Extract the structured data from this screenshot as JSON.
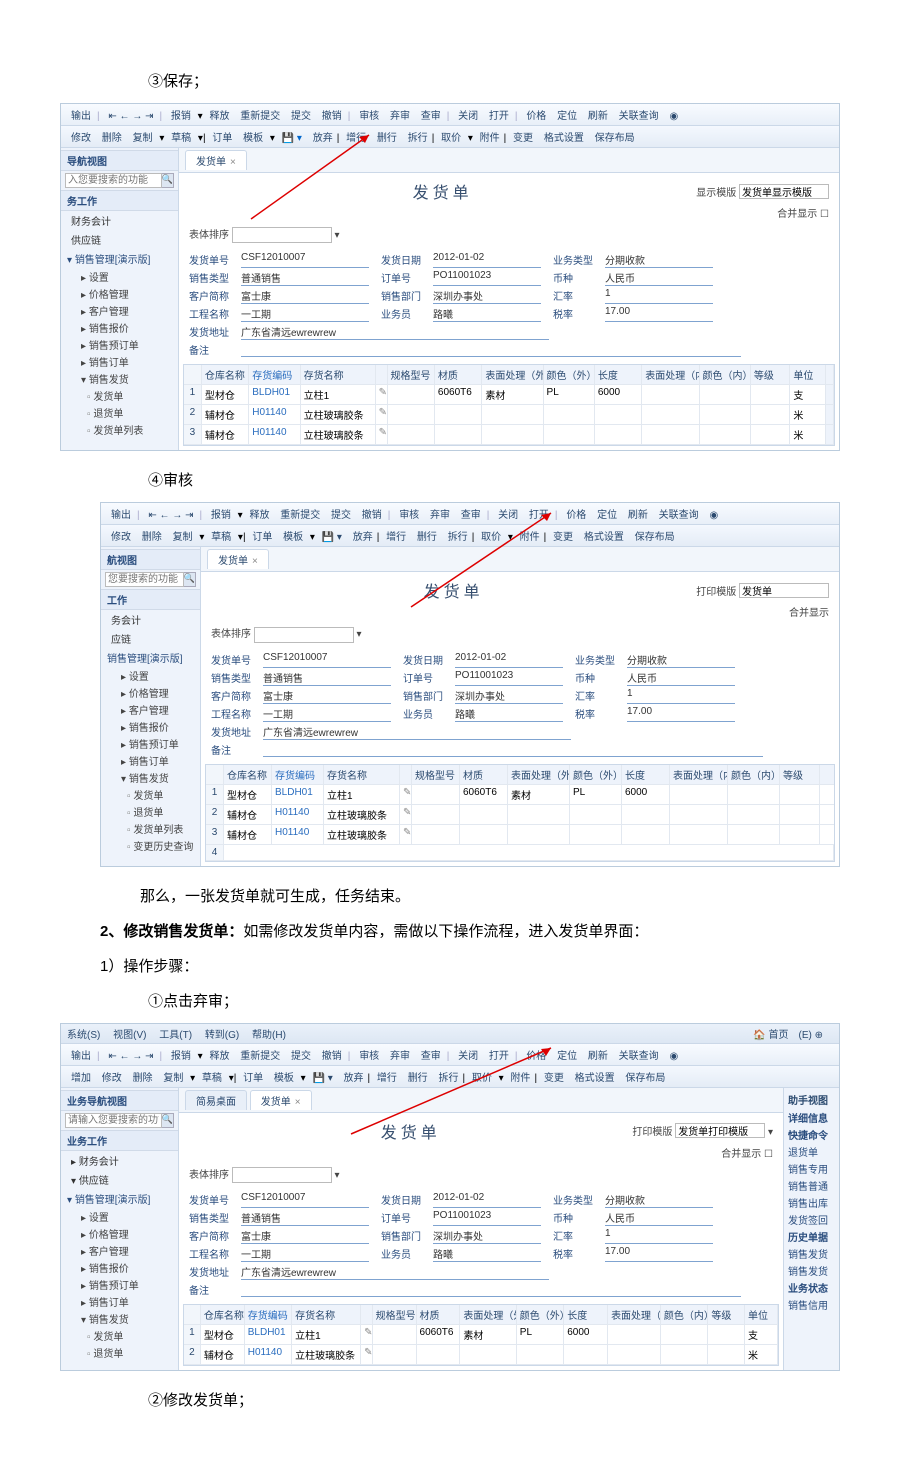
{
  "doc": {
    "step3": "③保存；",
    "step4": "④审核",
    "mid_sentence": "那么，一张发货单就可生成，任务结束。",
    "sec2_title": "2、修改销售发货单：",
    "sec2_body": "如需修改发货单内容，需做以下操作流程，进入发货单界面：",
    "sec2_steps_label": "1）操作步骤：",
    "step2_1": "①点击弃审；",
    "step2_2": "②修改发货单；"
  },
  "tb": {
    "output": "输出",
    "baogao": "报销",
    "shifang": "释放",
    "resubmit": "重新提交",
    "submit": "提交",
    "revoke": "撤销",
    "shenhe": "审核",
    "qishen": "弃审",
    "chashen": "查审",
    "close": "关闭",
    "open": "打开",
    "price": "价格",
    "locate": "定位",
    "refresh": "刷新",
    "relquery": "关联查询",
    "add": "增加",
    "modify": "修改",
    "delete": "删除",
    "copy": "复制",
    "draft": "草稿",
    "order": "订单",
    "template": "模板",
    "abandon": "放弃",
    "zengxing": "增行",
    "shanhang": "删行",
    "zhihang": "拆行",
    "quxia": "取价",
    "attach": "附件",
    "change": "变更",
    "format": "格式设置",
    "savelayout": "保存布局"
  },
  "nav": {
    "header": "导航视图",
    "search_ph": "入您要搜索的功能",
    "search_ph2": "请输入您要搜索的功能",
    "biz": "业务工作",
    "fin": "财务会计",
    "supply": "供应链",
    "salesmgr": "销售管理[演示版]",
    "setting": "设置",
    "pricemgr": "价格管理",
    "custmgr": "客户管理",
    "quote": "销售报价",
    "preorder": "销售预订单",
    "order": "销售订单",
    "ship": "销售发货",
    "ship_doc": "发货单",
    "return_doc": "退货单",
    "ship_list": "发货单列表",
    "history": "变更历史查询",
    "biz2": "务工作",
    "fin2": "务会计",
    "supply2": "应链",
    "work": "工作",
    "nav_header2": "航视图",
    "search_ph3": "您要搜索的功能",
    "abbr_fin": "务会计",
    "simple_desktop": "简易桌面"
  },
  "form": {
    "tab_label": "发货单",
    "tab_close": "×",
    "title": "发货单",
    "tmpl_label": "显示模版",
    "tmpl_val": "发货单显示模版",
    "tmpl_label2": "打印模版",
    "tmpl_val2": "发货单",
    "tmpl_val3": "发货单打印模版",
    "merge": "合并显示",
    "sort_label": "表体排序",
    "f_doc_no": "发货单号",
    "v_doc_no": "CSF12010007",
    "f_date": "发货日期",
    "v_date": "2012-01-02",
    "f_biztype": "业务类型",
    "v_biztype": "分期收款",
    "f_saletype": "销售类型",
    "v_saletype": "普通销售",
    "f_orderno": "订单号",
    "v_orderno": "PO11001023",
    "f_currency": "币种",
    "v_currency": "人民币",
    "f_cust": "客户简称",
    "v_cust": "富士康",
    "f_dept": "销售部门",
    "v_dept": "深圳办事处",
    "f_rate": "汇率",
    "v_rate": "1",
    "f_proj": "工程名称",
    "v_proj": "一工期",
    "f_salesman": "业务员",
    "v_salesman": "路曦",
    "f_tax": "税率",
    "v_tax": "17.00",
    "f_addr": "发货地址",
    "v_addr": "广东省清远ewrewrew",
    "f_remark": "备注"
  },
  "grid": {
    "h_wh": "仓库名称",
    "h_code": "存货编码",
    "h_name": "存货名称",
    "h_spec": "规格型号",
    "h_mat": "材质",
    "h_surf": "表面处理（外）",
    "h_color": "颜色（外）",
    "h_len": "长度",
    "h_surf2": "表面处理（内）",
    "h_color2": "颜色（内）",
    "h_grade": "等级",
    "h_unit": "单位",
    "rows": [
      {
        "n": "1",
        "wh": "型材仓",
        "code": "BLDH01",
        "name": "立柱1",
        "pen": "✎",
        "spec": "",
        "mat": "6060T6",
        "surf": "素材",
        "color": "PL",
        "len": "6000",
        "unit": "支"
      },
      {
        "n": "2",
        "wh": "辅材仓",
        "code": "H01140",
        "name": "立柱玻璃胶条",
        "pen": "✎",
        "spec": "",
        "mat": "",
        "surf": "",
        "color": "",
        "len": "",
        "unit": "米"
      },
      {
        "n": "3",
        "wh": "辅材仓",
        "code": "H01140",
        "name": "立柱玻璃胶条",
        "pen": "✎",
        "spec": "",
        "mat": "",
        "surf": "",
        "color": "",
        "len": "",
        "unit": "米"
      }
    ]
  },
  "menu": {
    "sys": "系统(S)",
    "view": "视图(V)",
    "tool": "工具(T)",
    "goto": "转到(G)",
    "help": "帮助(H)",
    "home": "首页"
  },
  "right": {
    "helper": "助手视图",
    "detail": "详细信息",
    "quick": "快捷命令",
    "items": [
      "退货单",
      "销售专用",
      "销售普通",
      "销售出库",
      "发货签回"
    ],
    "hist": "历史单据",
    "hist_items": [
      "销售发货",
      "销售发货"
    ],
    "state": "业务状态",
    "state_items": [
      "销售信用"
    ]
  }
}
